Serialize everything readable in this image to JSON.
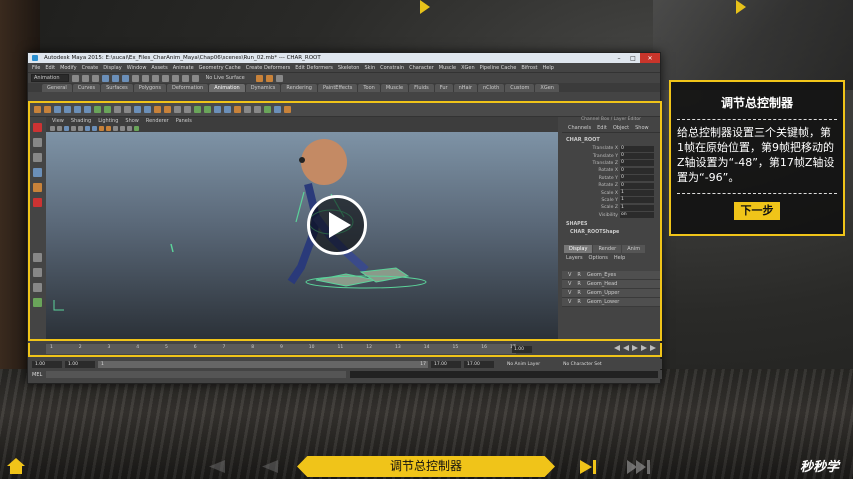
{
  "maya": {
    "title": "Autodesk Maya 2015: E:\\sucai\\Ex_Files_CharAnim_Maya\\Chap06\\scenes\\Run_02.mb*  ---  CHAR_ROOT",
    "menus": [
      "File",
      "Edit",
      "Modify",
      "Create",
      "Display",
      "Window",
      "Assets",
      "Animate",
      "Geometry Cache",
      "Create Deformers",
      "Edit Deformers",
      "Skeleton",
      "Skin",
      "Constrain",
      "Character",
      "Muscle",
      "XGen",
      "Pipeline Cache",
      "Bifrost",
      "Help"
    ],
    "mode": "Animation",
    "live_surface": "No Live Surface",
    "shelf_tabs": [
      "General",
      "Curves",
      "Surfaces",
      "Polygons",
      "Deformation",
      "Animation",
      "Dynamics",
      "Rendering",
      "PaintEffects",
      "Toon",
      "Muscle",
      "Fluids",
      "Fur",
      "nHair",
      "nCloth",
      "Custom",
      "XGen"
    ],
    "active_shelf_tab": "Animation",
    "viewport_menus": [
      "View",
      "Shading",
      "Lighting",
      "Show",
      "Renderer",
      "Panels"
    ],
    "channel_box": {
      "header": "Channel Box / Layer Editor",
      "tabs": [
        "Channels",
        "Edit",
        "Object",
        "Show"
      ],
      "object": "CHAR_ROOT",
      "attributes": [
        {
          "label": "Translate X",
          "value": "0"
        },
        {
          "label": "Translate Y",
          "value": "0"
        },
        {
          "label": "Translate Z",
          "value": "0"
        },
        {
          "label": "Rotate X",
          "value": "0"
        },
        {
          "label": "Rotate Y",
          "value": "0"
        },
        {
          "label": "Rotate Z",
          "value": "0"
        },
        {
          "label": "Scale X",
          "value": "1"
        },
        {
          "label": "Scale Y",
          "value": "1"
        },
        {
          "label": "Scale Z",
          "value": "1"
        },
        {
          "label": "Visibility",
          "value": "on"
        }
      ],
      "shapes_label": "SHAPES",
      "shape_name": "CHAR_ROOTShape",
      "layer_tabs": [
        "Display",
        "Render",
        "Anim"
      ],
      "layer_menus": [
        "Layers",
        "Options",
        "Help"
      ],
      "layers": [
        "Geom_Eyes",
        "Geom_Head",
        "Geom_Upper",
        "Geom_Lower"
      ],
      "layer_v": "V",
      "layer_r": "R"
    },
    "timeline": {
      "ticks": [
        "1",
        "2",
        "3",
        "4",
        "5",
        "6",
        "7",
        "8",
        "9",
        "10",
        "11",
        "12",
        "13",
        "14",
        "15",
        "16",
        "17"
      ],
      "current": "1.00"
    },
    "range": {
      "start": "1.00",
      "start_inner": "1.00",
      "slider_start": "1",
      "slider_end": "17",
      "end_inner": "17.00",
      "end": "17.00",
      "anim_layer": "No Anim Layer",
      "char_set": "No Character Set"
    },
    "mel_label": "MEL"
  },
  "panel": {
    "title": "调节总控制器",
    "text": "给总控制器设置三个关键帧，第1帧在原始位置，第9帧把移动的Z轴设置为“-48”，第17帧Z轴设置为“-96”。",
    "next_label": "下一步"
  },
  "nav": {
    "chapter": "调节总控制器",
    "brand": "秒秒学"
  },
  "colors": {
    "accent": "#f0c419"
  }
}
